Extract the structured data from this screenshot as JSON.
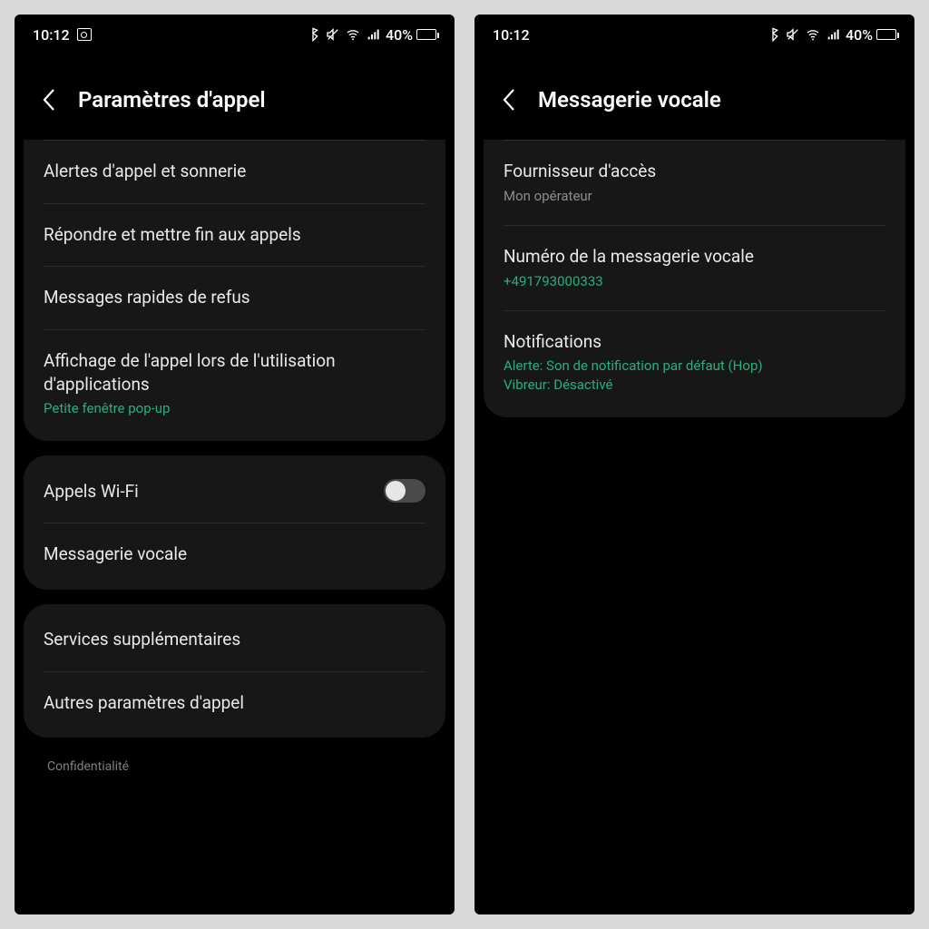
{
  "status": {
    "time_left": "10:12",
    "time_right": "10:12",
    "battery_text": "40%",
    "battery_fill_pct": 40
  },
  "left": {
    "title": "Paramètres d'appel",
    "group1": [
      {
        "label": "Alertes d'appel et sonnerie"
      },
      {
        "label": "Répondre et mettre fin aux appels"
      },
      {
        "label": "Messages rapides de refus"
      },
      {
        "label": "Affichage de l'appel lors de l'utilisation d'applications",
        "sub": "Petite fenêtre pop-up"
      }
    ],
    "group2": [
      {
        "label": "Appels Wi-Fi",
        "toggle": false
      },
      {
        "label": "Messagerie vocale"
      }
    ],
    "group3": [
      {
        "label": "Services supplémentaires"
      },
      {
        "label": "Autres paramètres d'appel"
      }
    ],
    "footer": "Confidentialité"
  },
  "right": {
    "title": "Messagerie vocale",
    "items": [
      {
        "label": "Fournisseur d'accès",
        "sub_muted": "Mon opérateur"
      },
      {
        "label": "Numéro de la messagerie vocale",
        "sub": "+491793000333"
      },
      {
        "label": "Notifications",
        "sub": "Alerte: Son de notification par défaut (Hop)\nVibreur: Désactivé"
      }
    ]
  },
  "icons": {
    "bluetooth": "bluetooth-icon",
    "mute": "mute-icon",
    "wifi": "wifi-icon",
    "signal": "signal-icon",
    "gallery": "gallery-icon",
    "battery": "battery-icon",
    "back": "back-icon"
  }
}
